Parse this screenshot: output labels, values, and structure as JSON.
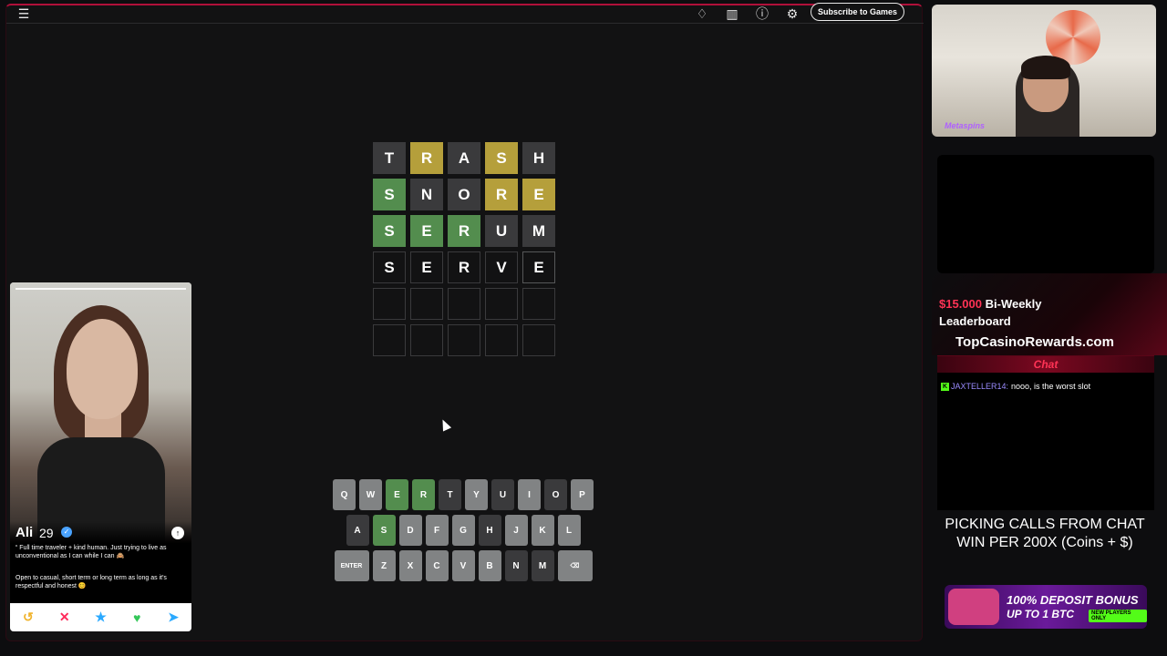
{
  "game": {
    "topbar": {
      "menu_icon": "hamburger-menu-icon",
      "icons": [
        "lightbulb-icon",
        "stats-icon",
        "help-icon",
        "settings-icon"
      ],
      "subscribe_label": "Subscribe to Games"
    },
    "board": [
      [
        {
          "l": "T",
          "s": "absent"
        },
        {
          "l": "R",
          "s": "present"
        },
        {
          "l": "A",
          "s": "absent"
        },
        {
          "l": "S",
          "s": "present"
        },
        {
          "l": "H",
          "s": "absent"
        }
      ],
      [
        {
          "l": "S",
          "s": "correct"
        },
        {
          "l": "N",
          "s": "absent"
        },
        {
          "l": "O",
          "s": "absent"
        },
        {
          "l": "R",
          "s": "present"
        },
        {
          "l": "E",
          "s": "present"
        }
      ],
      [
        {
          "l": "S",
          "s": "correct"
        },
        {
          "l": "E",
          "s": "correct"
        },
        {
          "l": "R",
          "s": "correct"
        },
        {
          "l": "U",
          "s": "absent"
        },
        {
          "l": "M",
          "s": "absent"
        }
      ],
      [
        {
          "l": "S",
          "s": "tbd"
        },
        {
          "l": "E",
          "s": "tbd"
        },
        {
          "l": "R",
          "s": "tbd"
        },
        {
          "l": "V",
          "s": "tbd"
        },
        {
          "l": "E",
          "s": "tbd-active"
        }
      ],
      [
        {
          "l": "",
          "s": "empty"
        },
        {
          "l": "",
          "s": "empty"
        },
        {
          "l": "",
          "s": "empty"
        },
        {
          "l": "",
          "s": "empty"
        },
        {
          "l": "",
          "s": "empty"
        }
      ],
      [
        {
          "l": "",
          "s": "empty"
        },
        {
          "l": "",
          "s": "empty"
        },
        {
          "l": "",
          "s": "empty"
        },
        {
          "l": "",
          "s": "empty"
        },
        {
          "l": "",
          "s": "empty"
        }
      ]
    ],
    "keyboard": [
      [
        {
          "k": "Q",
          "s": "unused"
        },
        {
          "k": "W",
          "s": "unused"
        },
        {
          "k": "E",
          "s": "correct"
        },
        {
          "k": "R",
          "s": "correct"
        },
        {
          "k": "T",
          "s": "absent"
        },
        {
          "k": "Y",
          "s": "unused"
        },
        {
          "k": "U",
          "s": "absent"
        },
        {
          "k": "I",
          "s": "unused"
        },
        {
          "k": "O",
          "s": "absent"
        },
        {
          "k": "P",
          "s": "unused"
        }
      ],
      [
        {
          "k": "A",
          "s": "absent"
        },
        {
          "k": "S",
          "s": "correct"
        },
        {
          "k": "D",
          "s": "unused"
        },
        {
          "k": "F",
          "s": "unused"
        },
        {
          "k": "G",
          "s": "unused"
        },
        {
          "k": "H",
          "s": "absent"
        },
        {
          "k": "J",
          "s": "unused"
        },
        {
          "k": "K",
          "s": "unused"
        },
        {
          "k": "L",
          "s": "unused"
        }
      ],
      [
        {
          "k": "ENTER",
          "s": "unused",
          "wide": true
        },
        {
          "k": "Z",
          "s": "unused"
        },
        {
          "k": "X",
          "s": "unused"
        },
        {
          "k": "C",
          "s": "unused"
        },
        {
          "k": "V",
          "s": "unused"
        },
        {
          "k": "B",
          "s": "unused"
        },
        {
          "k": "N",
          "s": "absent"
        },
        {
          "k": "M",
          "s": "absent"
        },
        {
          "k": "⌫",
          "s": "unused",
          "wide": true
        }
      ]
    ],
    "colors": {
      "correct": "#538d4e",
      "present": "#b59f3b",
      "absent": "#3a3a3c",
      "unused": "#818384"
    }
  },
  "card": {
    "name": "Ali",
    "age": "29",
    "verified_icon": "verified-check-icon",
    "bio_line1": "“ Full time traveler + kind human. Just trying to live as unconventional as I can while I can 🙈",
    "bio_line2": "Open to casual, short term or long term as long as it's respectful and honest 😊",
    "actions": [
      {
        "name": "rewind-icon",
        "glyph": "↺",
        "color": "#f0b32c"
      },
      {
        "name": "nope-icon",
        "glyph": "✕",
        "color": "#ff2a5a"
      },
      {
        "name": "super-like-icon",
        "glyph": "★",
        "color": "#2aa9ff"
      },
      {
        "name": "like-icon",
        "glyph": "♥",
        "color": "#34c759"
      },
      {
        "name": "boost-icon",
        "glyph": "➤",
        "color": "#2aa9ff"
      }
    ]
  },
  "stream": {
    "webcam_label": "Metaspins",
    "promo": {
      "amount": "$15.000",
      "line1_rest": " Bi-Weekly",
      "line2": "Leaderboard",
      "site": "TopCasinoRewards.com"
    },
    "chat": {
      "header": "Chat",
      "badge": "K",
      "user": "JAXTELLER14:",
      "message": "nooo, is the worst slot"
    },
    "calls_line1": "PICKING CALLS FROM CHAT",
    "calls_line2": "WIN PER 200X (Coins + $)",
    "bonus": {
      "line1": "100% DEPOSIT BONUS",
      "line2": "UP TO 1 BTC",
      "tag": "NEW PLAYERS ONLY"
    }
  }
}
